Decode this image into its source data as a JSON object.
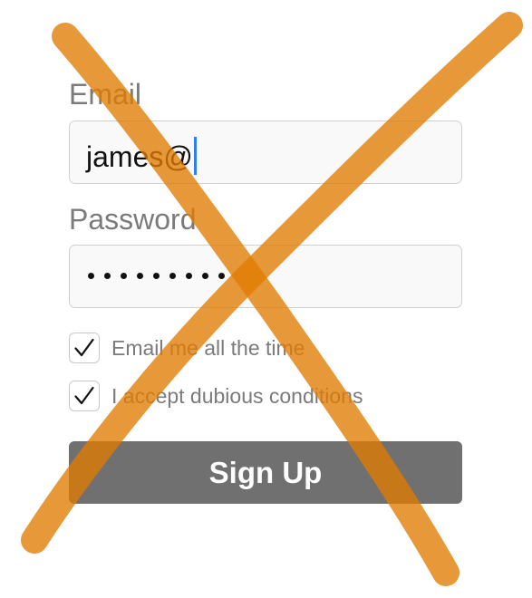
{
  "form": {
    "email_label": "Email",
    "email_value": "james@",
    "password_label": "Password",
    "password_dot_count": 9,
    "checkboxes": [
      {
        "label": "Email me all the time",
        "checked": true
      },
      {
        "label": "I accept dubious conditions",
        "checked": true
      }
    ],
    "signup_label": "Sign Up"
  },
  "colors": {
    "label_text": "#7b7b7b",
    "input_background": "#f9f9f9",
    "input_border": "#d0d0d0",
    "caret": "#2f7ef6",
    "button_background": "#707070",
    "button_text": "#ffffff",
    "overlay_cross": "#e07b00"
  },
  "overlay": {
    "icon": "hand-drawn-x-icon"
  }
}
